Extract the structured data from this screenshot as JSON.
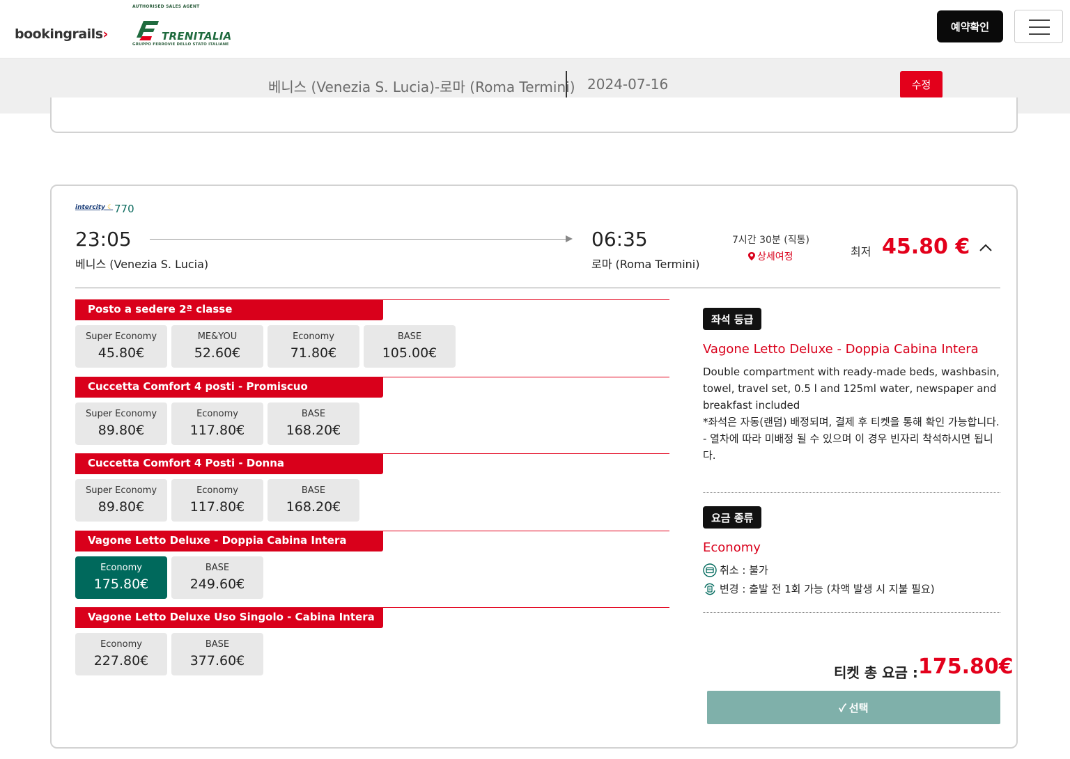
{
  "header": {
    "brand": "bookingrails",
    "authorised": "AUTHORISED SALES AGENT",
    "partner_name": "TRENITALIA",
    "partner_sub": "GRUPPO FERROVIE DELLO STATO ITALIANE",
    "confirm_label": "예약확인",
    "menu_icon": "hamburger-icon"
  },
  "search": {
    "route": "베니스 (Venezia S. Lucia)-로마 (Roma Termini)",
    "date": "2024-07-16",
    "edit_label": "수정"
  },
  "train": {
    "logo_text": "intercity",
    "number": "770",
    "dep_time": "23:05",
    "dep_station": "베니스 (Venezia S. Lucia)",
    "arr_time": "06:35",
    "arr_station": "로마 (Roma Termini)",
    "duration": "7시간 30분 (직통)",
    "detail_label": "상세여정",
    "min_label": "최저",
    "min_price": "45.80 €"
  },
  "classes": [
    {
      "title": "Posto a sedere 2ª classe",
      "fares": [
        {
          "name": "Super Economy",
          "price": "45.80€"
        },
        {
          "name": "ME&YOU",
          "price": "52.60€"
        },
        {
          "name": "Economy",
          "price": "71.80€"
        },
        {
          "name": "BASE",
          "price": "105.00€"
        }
      ]
    },
    {
      "title": "Cuccetta Comfort 4 posti - Promiscuo",
      "fares": [
        {
          "name": "Super Economy",
          "price": "89.80€"
        },
        {
          "name": "Economy",
          "price": "117.80€"
        },
        {
          "name": "BASE",
          "price": "168.20€"
        }
      ]
    },
    {
      "title": "Cuccetta Comfort 4 Posti - Donna",
      "fares": [
        {
          "name": "Super Economy",
          "price": "89.80€"
        },
        {
          "name": "Economy",
          "price": "117.80€"
        },
        {
          "name": "BASE",
          "price": "168.20€"
        }
      ]
    },
    {
      "title": "Vagone Letto Deluxe - Doppia Cabina Intera",
      "fares": [
        {
          "name": "Economy",
          "price": "175.80€",
          "selected": true
        },
        {
          "name": "BASE",
          "price": "249.60€"
        }
      ]
    },
    {
      "title": "Vagone Letto Deluxe Uso Singolo - Cabina Intera",
      "fares": [
        {
          "name": "Economy",
          "price": "227.80€"
        },
        {
          "name": "BASE",
          "price": "377.60€"
        }
      ]
    }
  ],
  "panel": {
    "seat_badge": "좌석 등급",
    "seat_title": "Vagone Letto Deluxe - Doppia Cabina Intera",
    "seat_desc_1": "Double compartment with ready-made beds, washbasin, towel, travel set, 0.5 l and 125ml water, newspaper and breakfast included",
    "seat_desc_2": "*좌석은 자동(랜덤) 배정되며, 결제 후 티켓을 통해 확인 가능합니다.",
    "seat_desc_3": "- 열차에 따라 미배정 될 수 있으며 이 경우 빈자리 착석하시면 됩니다.",
    "fare_badge": "요금 종류",
    "fare_title": "Economy",
    "cancel": "취소 : 불가",
    "change": "변경 : 출발 전 1회 가능 (차액 발생 시 지불 필요)",
    "total_label": "티켓 총 요금 :",
    "total_price": "175.80€",
    "select_label": "✓ 선택"
  },
  "colors": {
    "accent_red": "#e3001b",
    "selected_green": "#00695c",
    "select_button": "#7fb0aa"
  }
}
